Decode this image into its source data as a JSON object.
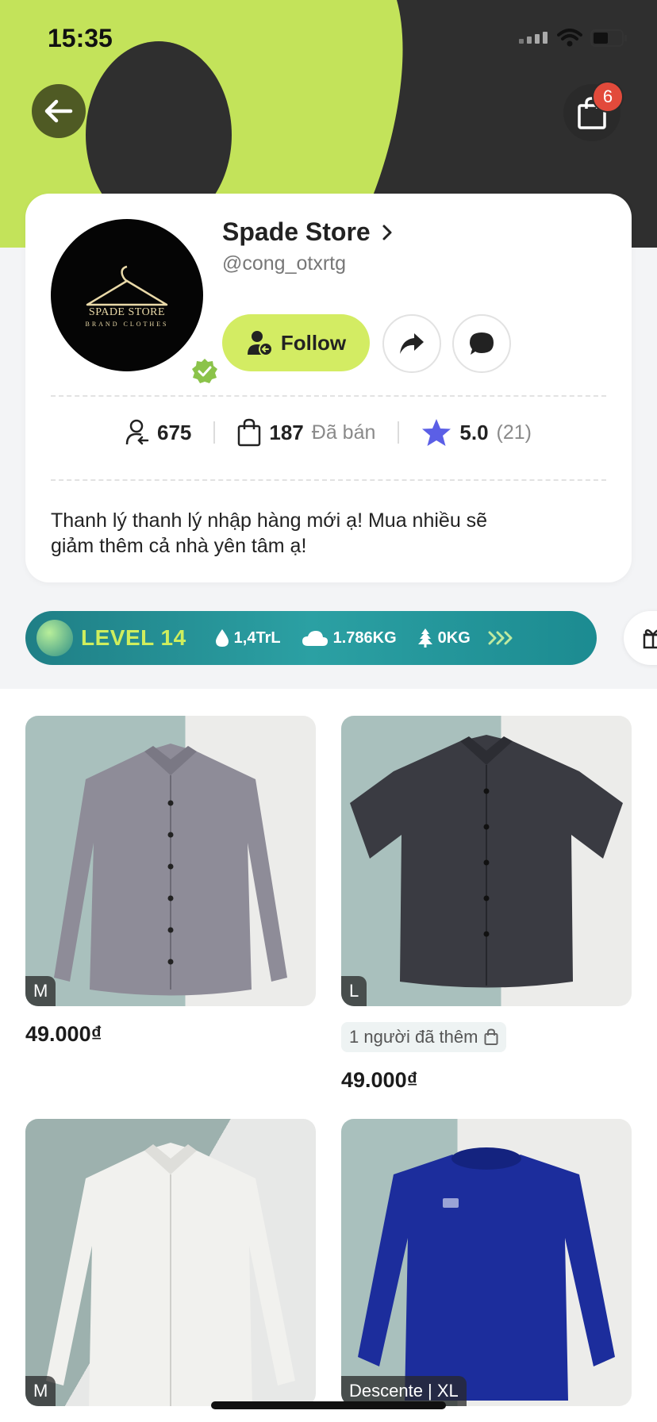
{
  "status_bar": {
    "time": "15:35"
  },
  "header": {
    "cart_count": "6"
  },
  "colors": {
    "accent": "#d3ec63",
    "star": "#5b5fe6",
    "badge": "#e24a3b"
  },
  "store": {
    "name": "Spade Store",
    "handle": "@cong_otxrtg",
    "avatar_title": "SPADE STORE",
    "avatar_subtitle": "BRAND CLOTHES",
    "follow_label": "Follow",
    "stats": {
      "followers": "675",
      "sold_count": "187",
      "sold_label": "Đã bán",
      "rating": "5.0",
      "review_count": "(21)"
    },
    "bio_line1": "Thanh lý thanh lý nhập hàng mới ạ! Mua nhiều sẽ",
    "bio_line2": "giảm thêm cả nhà yên tâm ạ!"
  },
  "level": {
    "label": "LEVEL 14",
    "water": "1,4TrL",
    "co2": "1.786KG",
    "tree": "0KG"
  },
  "products": [
    {
      "size": "M",
      "price": "49.000₫",
      "added_text": ""
    },
    {
      "size": "L",
      "price": "49.000₫",
      "added_text": "1 người đã thêm"
    },
    {
      "size": "M",
      "price": "",
      "added_text": ""
    },
    {
      "size": "Descente | XL",
      "price": "",
      "added_text": ""
    }
  ]
}
